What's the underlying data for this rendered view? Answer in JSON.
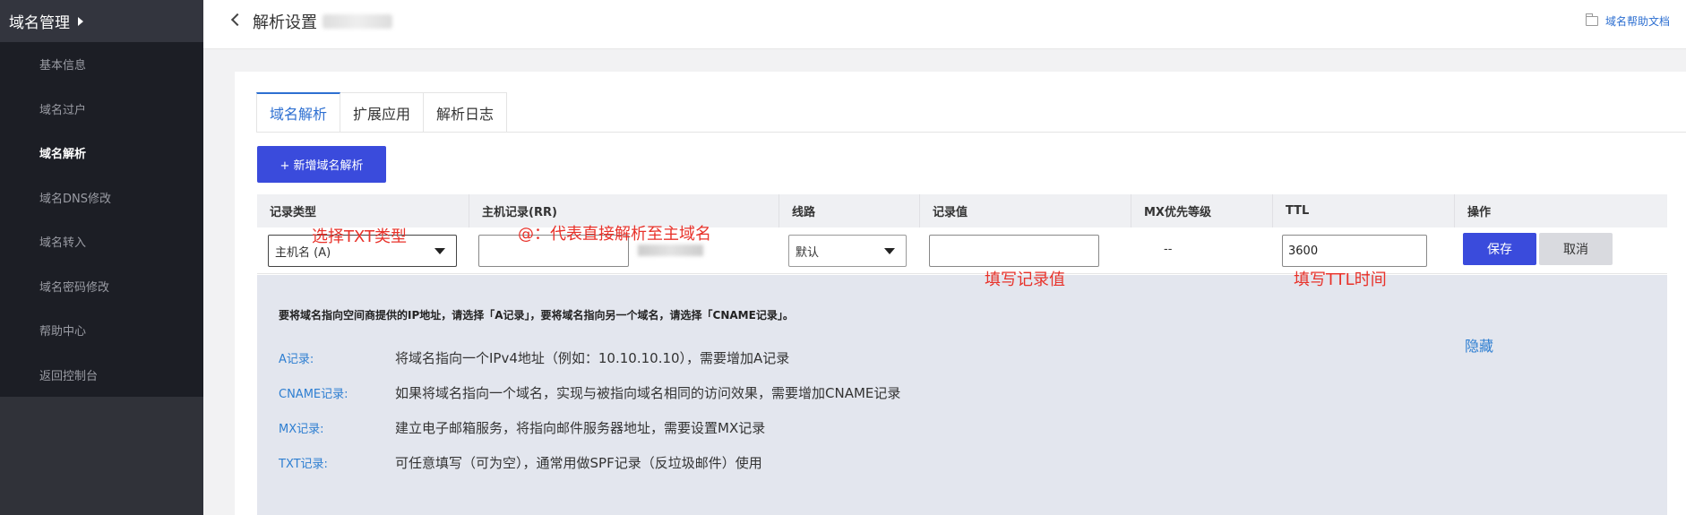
{
  "sidebar": {
    "title": "域名管理",
    "items": [
      {
        "label": "基本信息"
      },
      {
        "label": "域名过户"
      },
      {
        "label": "域名解析"
      },
      {
        "label": "域名DNS修改"
      },
      {
        "label": "域名转入"
      },
      {
        "label": "域名密码修改"
      },
      {
        "label": "帮助中心"
      },
      {
        "label": "返回控制台"
      }
    ],
    "active_item": "域名解析"
  },
  "topbar": {
    "title": "解析设置",
    "help_link": "域名帮助文档"
  },
  "tabs": [
    {
      "label": "域名解析"
    },
    {
      "label": "扩展应用"
    },
    {
      "label": "解析日志"
    }
  ],
  "add_button": "+ 新增域名解析",
  "table": {
    "headers": [
      "记录类型",
      "主机记录(RR)",
      "线路",
      "记录值",
      "MX优先等级",
      "TTL",
      "操作"
    ],
    "row": {
      "record_type": "主机名 (A)",
      "host_record": "",
      "line": "默认",
      "record_value": "",
      "mx_priority": "--",
      "ttl": "3600",
      "save": "保存",
      "cancel": "取消"
    }
  },
  "info": {
    "lead": "要将域名指向空间商提供的IP地址，请选择「A记录」，要将域名指向另一个域名，请选择「CNAME记录」。",
    "rows": [
      {
        "key": "A记录:",
        "desc": "将域名指向一个IPv4地址（例如：10.10.10.10），需要增加A记录"
      },
      {
        "key": "CNAME记录:",
        "desc": "如果将域名指向一个域名，实现与被指向域名相同的访问效果，需要增加CNAME记录"
      },
      {
        "key": "MX记录:",
        "desc": "建立电子邮箱服务，将指向邮件服务器地址，需要设置MX记录"
      },
      {
        "key": "TXT记录:",
        "desc": "可任意填写（可为空），通常用做SPF记录（反垃圾邮件）使用"
      }
    ],
    "hide": "隐藏"
  },
  "annotations": {
    "type": "选择TXT类型",
    "host": "@：代表直接解析至主域名",
    "value": "填写记录值",
    "ttl": "填写TTL时间"
  },
  "colors": {
    "primary": "#3a4bdc",
    "link": "#2d7ed1",
    "annotation": "#e8322a",
    "sidebar_bg": "#252731"
  }
}
